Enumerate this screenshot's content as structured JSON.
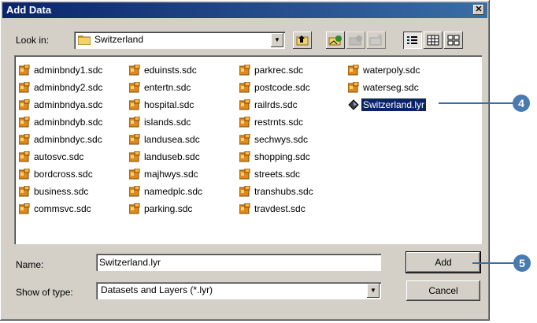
{
  "window": {
    "title": "Add Data"
  },
  "look_in": {
    "label": "Look in:",
    "value": "Switzerland"
  },
  "toolbar": {
    "icons": [
      "up-one-level-icon",
      "connect-to-folder-icon",
      "disconnect-folder-icon",
      "new-folder-icon",
      "list-view-icon",
      "details-view-icon",
      "thumbnails-view-icon"
    ]
  },
  "files": {
    "col1": [
      "adminbndy1.sdc",
      "adminbndy2.sdc",
      "adminbndya.sdc",
      "adminbndyb.sdc",
      "adminbndyc.sdc",
      "autosvc.sdc",
      "bordcross.sdc",
      "business.sdc",
      "commsvc.sdc"
    ],
    "col2": [
      "eduinsts.sdc",
      "entertn.sdc",
      "hospital.sdc",
      "islands.sdc",
      "landusea.sdc",
      "landuseb.sdc",
      "majhwys.sdc",
      "namedplc.sdc",
      "parking.sdc"
    ],
    "col3": [
      "parkrec.sdc",
      "postcode.sdc",
      "railrds.sdc",
      "restrnts.sdc",
      "sechwys.sdc",
      "shopping.sdc",
      "streets.sdc",
      "transhubs.sdc",
      "travdest.sdc"
    ],
    "col4": [
      "waterpoly.sdc",
      "waterseg.sdc"
    ],
    "selected": "Switzerland.lyr"
  },
  "name_field": {
    "label": "Name:",
    "value": "Switzerland.lyr"
  },
  "type_field": {
    "label": "Show of type:",
    "value": "Datasets and Layers (*.lyr)"
  },
  "buttons": {
    "add": "Add",
    "cancel": "Cancel"
  },
  "callouts": {
    "selected_layer": "4",
    "add_button": "5"
  },
  "colors": {
    "title_bar": "#0a246a",
    "dialog_bg": "#d4d0c8",
    "selection": "#0a246a",
    "callout": "#4a7bb0"
  }
}
